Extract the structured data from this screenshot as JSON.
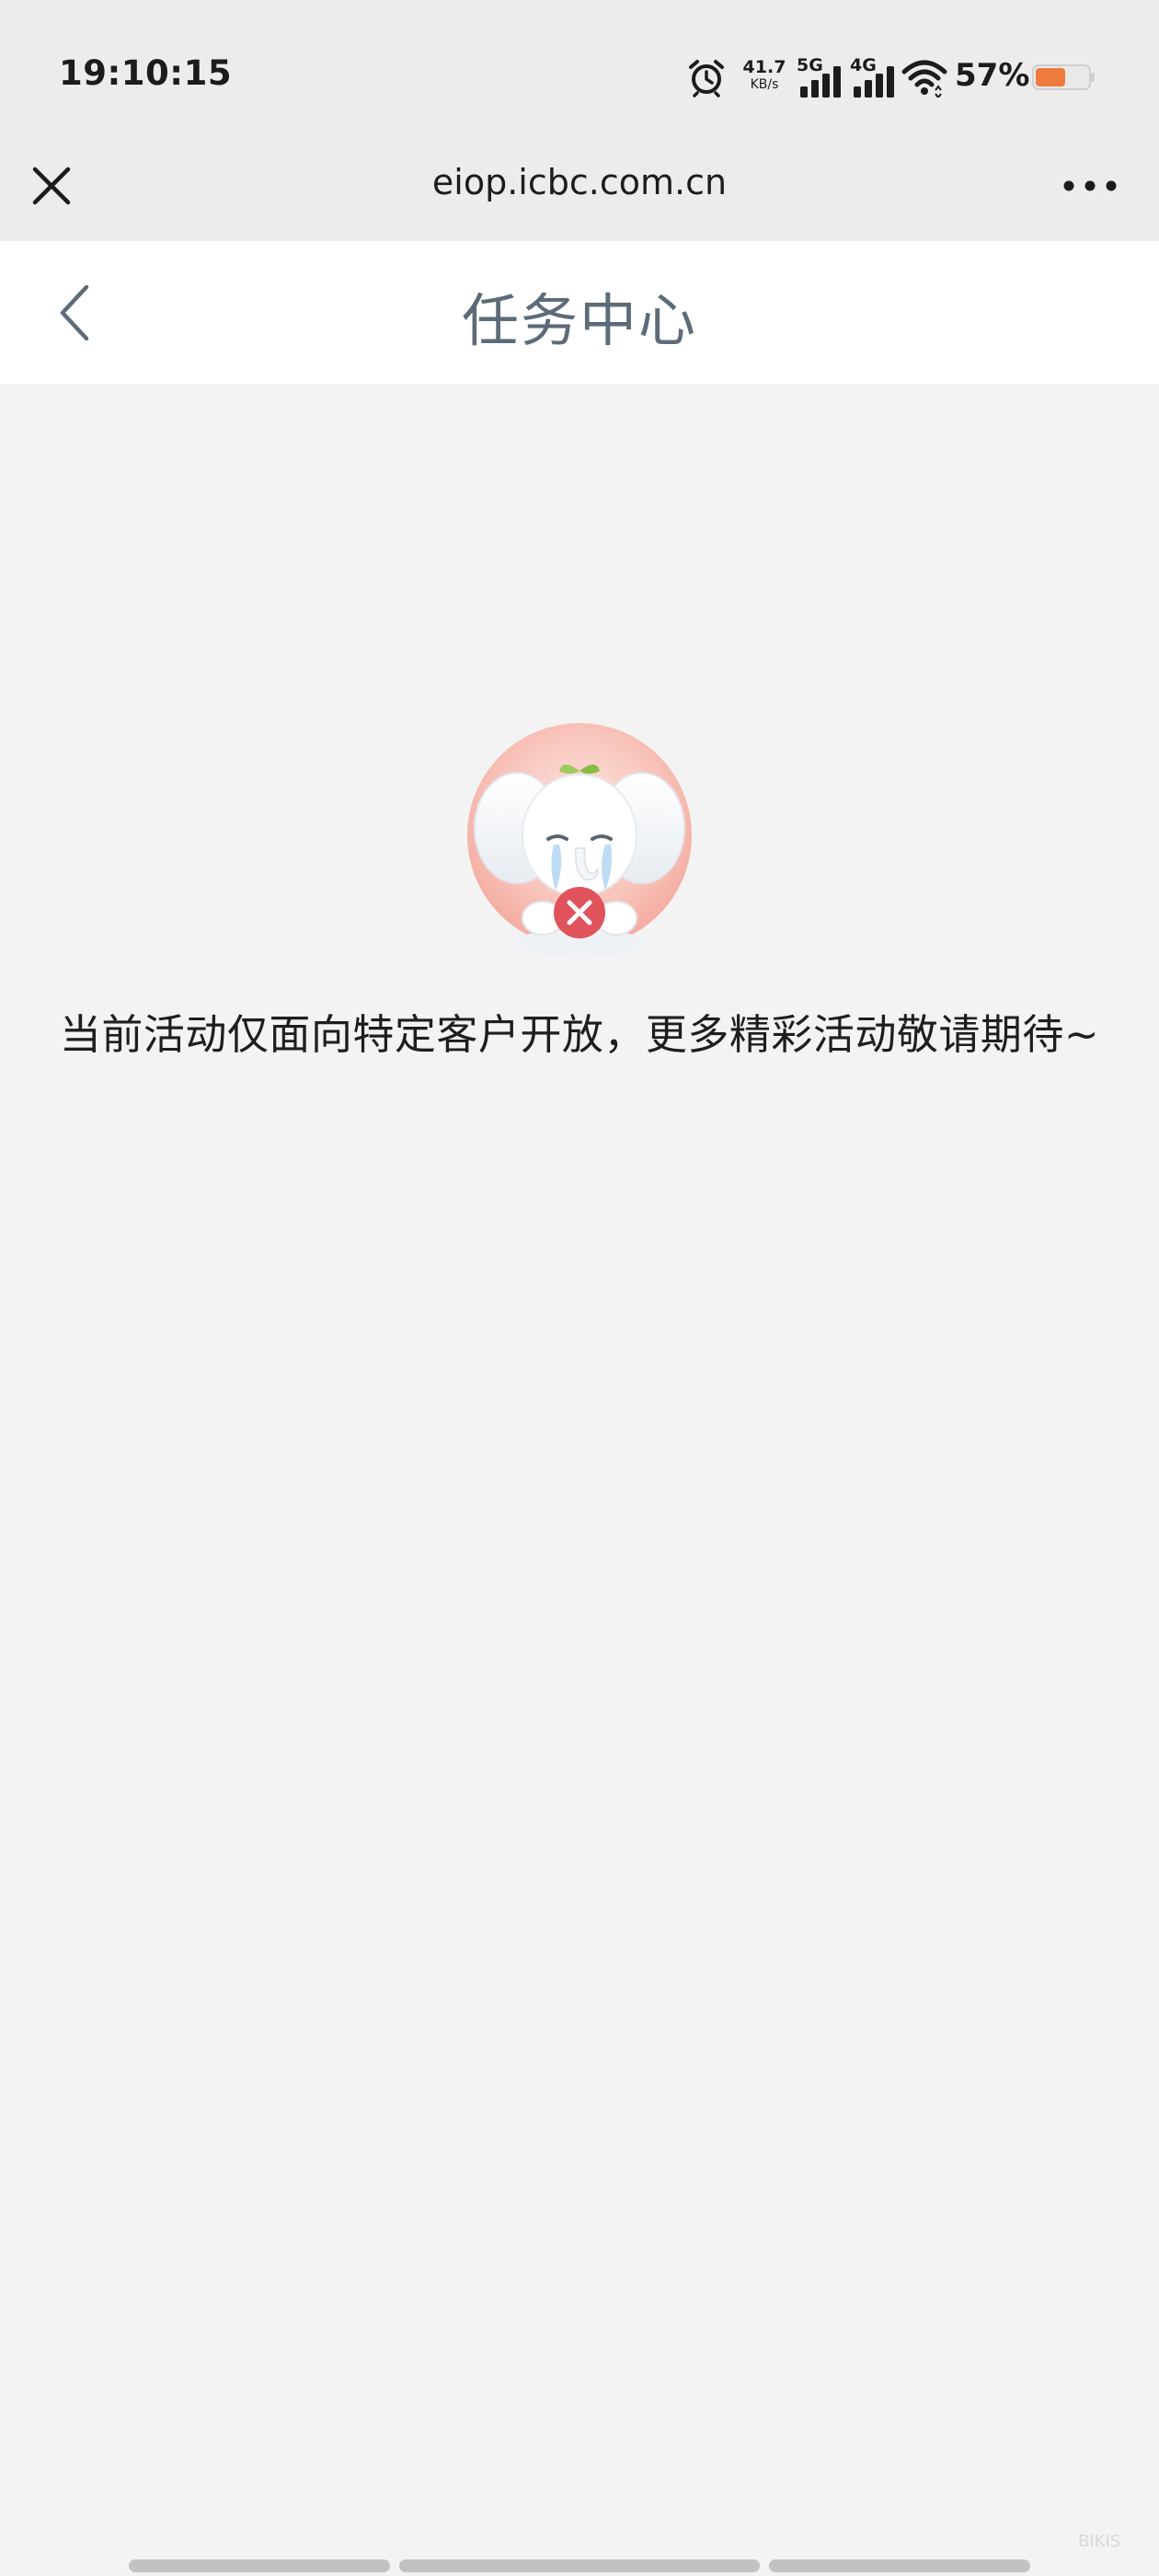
{
  "status_bar": {
    "time": "19:10:15",
    "net_speed_value": "41.7",
    "net_speed_unit": "KB/s",
    "signal_1_label": "5G",
    "signal_2_label": "4G",
    "battery_percent": "57%",
    "battery_level": 0.57,
    "icons": [
      "alarm-icon",
      "signal-5g-icon",
      "signal-4g-icon",
      "wifi-icon",
      "battery-icon"
    ]
  },
  "browser": {
    "url": "eiop.icbc.com.cn",
    "close_icon": "close-icon",
    "more_icon": "more-icon"
  },
  "header": {
    "title": "任务中心",
    "back_icon": "chevron-left-icon"
  },
  "empty_state": {
    "illustration": "crying-elephant-illustration",
    "message": "当前活动仅面向特定客户开放，更多精彩活动敬请期待~"
  },
  "watermark": "BIKIS",
  "colors": {
    "status_bg": "#ececec",
    "page_bg": "#f3f3f3",
    "header_bg": "#ffffff",
    "title_color": "#5d6b79",
    "battery_fill": "#f07b3f",
    "badge_red": "#e0525c"
  }
}
